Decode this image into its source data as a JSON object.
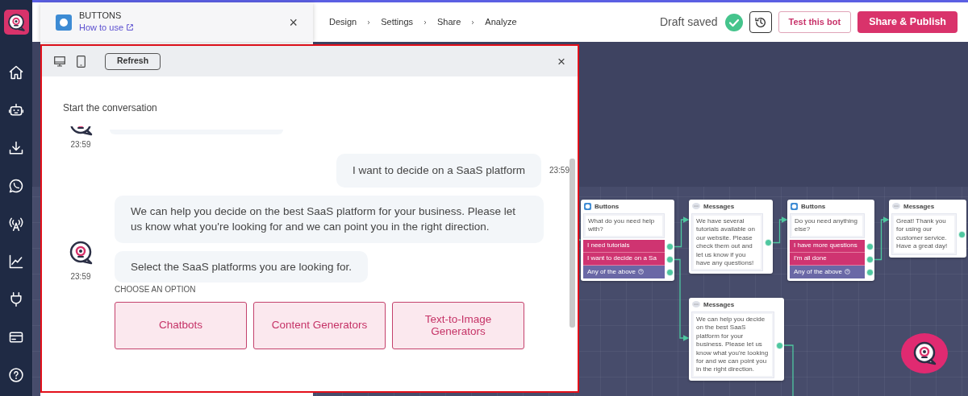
{
  "header": {
    "block": {
      "title": "BUTTONS",
      "link": "How to use",
      "close": "×"
    },
    "steps": [
      {
        "label": "Design"
      },
      {
        "label": "Settings"
      },
      {
        "label": "Share"
      },
      {
        "label": "Analyze"
      }
    ],
    "status": "Draft saved",
    "actions": [
      {
        "label": "Test this bot",
        "kind": "outline"
      },
      {
        "label": "Share & Publish",
        "kind": "primary"
      }
    ]
  },
  "preview": {
    "refresh": "Refresh",
    "close": "×",
    "intro": "Start the conversation",
    "messages": [
      {
        "kind": "bot_scrolled",
        "time": "23:59"
      },
      {
        "kind": "user",
        "text": "I want to decide on a SaaS platform",
        "time": "23:59"
      },
      {
        "kind": "bot",
        "texts": [
          "We can help you decide on the best SaaS platform for your business. Please let us know what you're looking for and we can point you in the right direction.",
          "Select the SaaS platforms you are looking for."
        ],
        "time": "23:59"
      }
    ],
    "choices": {
      "label": "CHOOSE AN OPTION",
      "options": [
        "Chatbots",
        "Content Generators",
        "Text-to-Image Generators"
      ]
    }
  },
  "flow": {
    "nodes": [
      {
        "kind": "buttons",
        "title": "Buttons",
        "prompt": "What do you need help with?",
        "options": [
          {
            "label": "I need tutorials",
            "kind": "choice"
          },
          {
            "label": "I want to decide on a Sa",
            "kind": "choice"
          },
          {
            "label": "Any of the above",
            "kind": "fallback"
          }
        ]
      },
      {
        "kind": "messages",
        "title": "Messages",
        "text": "We have several tutorials available on our website. Please check them out and let us know if you have any questions!"
      },
      {
        "kind": "buttons",
        "title": "Buttons",
        "prompt": "Do you need anything else?",
        "options": [
          {
            "label": "I have more questions",
            "kind": "choice"
          },
          {
            "label": "I'm all done",
            "kind": "choice"
          },
          {
            "label": "Any of the above",
            "kind": "fallback"
          }
        ]
      },
      {
        "kind": "messages",
        "title": "Messages",
        "text": "Great! Thank you for using our customer service. Have a great day!"
      },
      {
        "kind": "messages",
        "title": "Messages",
        "text": "We can help you decide on the best SaaS platform for your business. Please let us know what you're looking for and we can point you in the right direction."
      }
    ]
  }
}
